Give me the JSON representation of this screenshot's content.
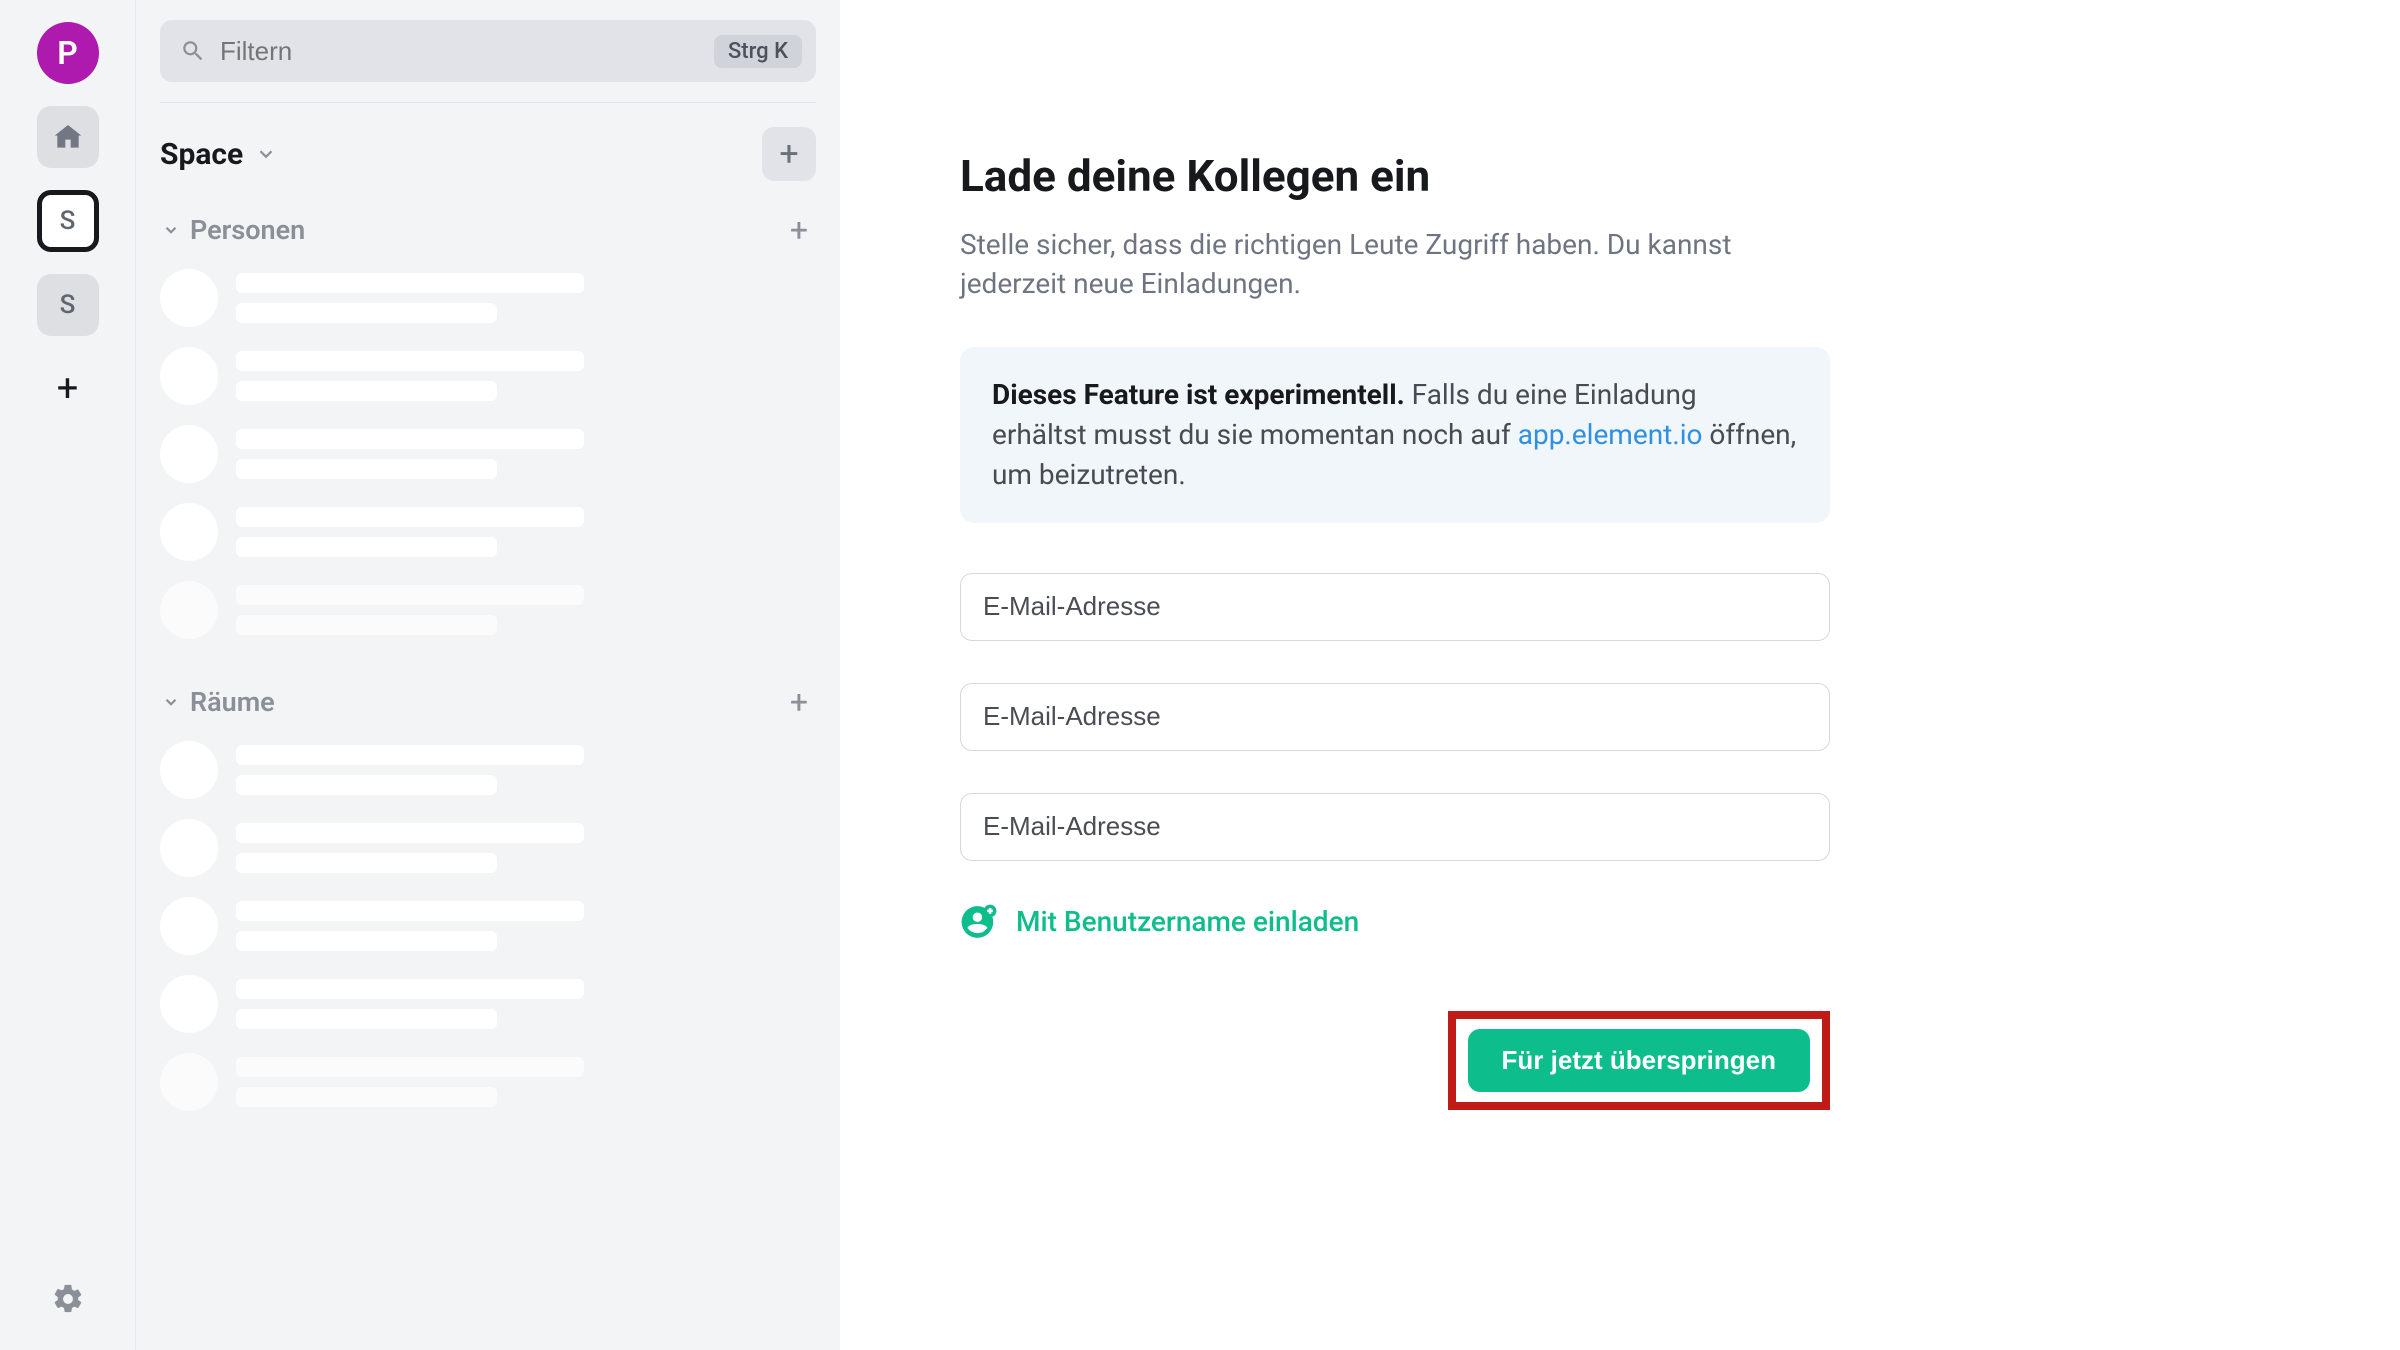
{
  "rail": {
    "avatar_letter": "P",
    "space1_letter": "S",
    "space2_letter": "S"
  },
  "sidebar": {
    "search_placeholder": "Filtern",
    "search_shortcut": "Strg K",
    "space_title": "Space",
    "sections": {
      "people": "Personen",
      "rooms": "Räume"
    }
  },
  "main": {
    "heading": "Lade deine Kollegen ein",
    "subtitle": "Stelle sicher, dass die richtigen Leute Zugriff haben. Du kannst jederzeit neue Einladungen.",
    "notice_bold": "Dieses Feature ist experimentell.",
    "notice_text_before_link": " Falls du eine Einladung erhältst musst du sie momentan noch auf ",
    "notice_link": "app.element.io",
    "notice_text_after_link": " öffnen, um beizutreten.",
    "email_placeholder": "E-Mail-Adresse",
    "invite_by_username": "Mit Benutzername einladen",
    "skip_label": "Für jetzt überspringen"
  }
}
